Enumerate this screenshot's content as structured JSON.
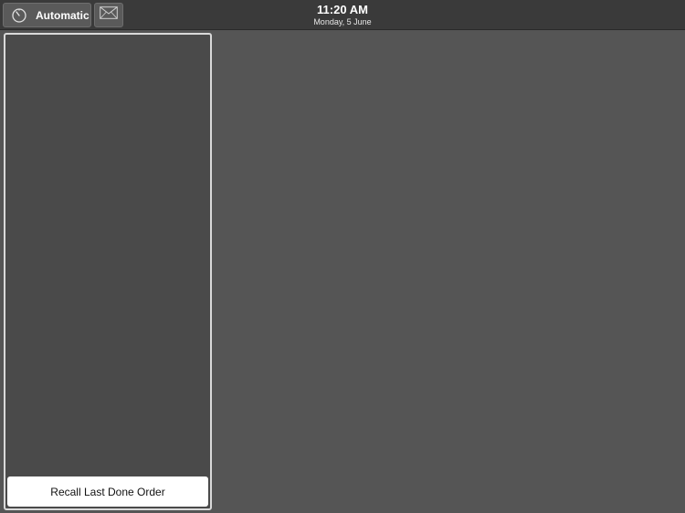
{
  "topbar": {
    "mode_button": {
      "label": "Automatic",
      "icon": "timer-icon"
    },
    "mail_button": {
      "icon": "envelope-icon"
    },
    "clock": {
      "time": "11:20 AM",
      "date": "Monday, 5 June"
    }
  },
  "order_panel": {
    "recall_button_label": "Recall Last Done Order"
  },
  "colors": {
    "topbar": "#3a3a3a",
    "background": "#555555",
    "panel": "#4a4a4a",
    "panel_border": "#d9d9d9"
  }
}
